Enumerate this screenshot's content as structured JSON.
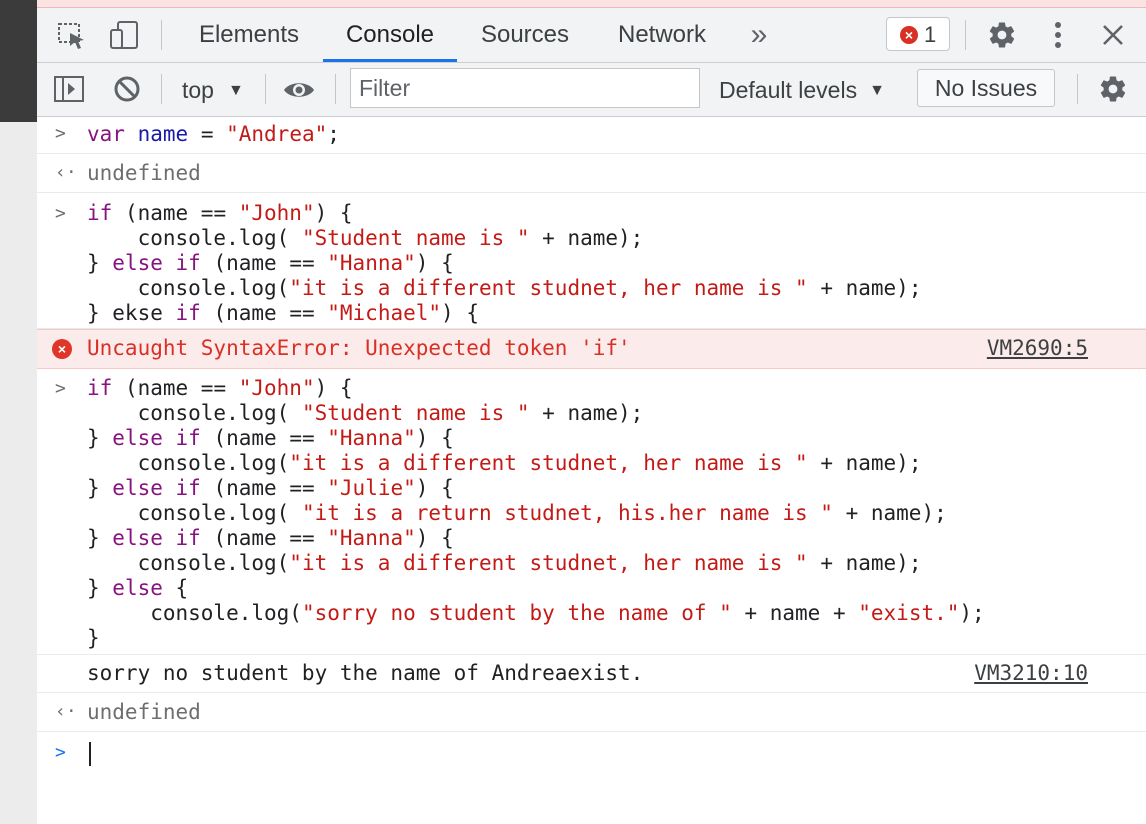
{
  "colors": {
    "accent": "#1a73e8",
    "error": "#d93025",
    "keyword": "#881280",
    "string": "#c41a16",
    "variable": "#1a1aa6"
  },
  "tabs": [
    {
      "label": "Elements"
    },
    {
      "label": "Console"
    },
    {
      "label": "Sources"
    },
    {
      "label": "Network"
    }
  ],
  "overflow_label": "»",
  "error_count": "1",
  "toolbar": {
    "context": "top",
    "filter_placeholder": "Filter",
    "levels": "Default levels",
    "issues": "No Issues"
  },
  "console": {
    "undefined_label": "undefined",
    "error_text": "Uncaught SyntaxError: Unexpected token 'if'",
    "error_link": "VM2690:5",
    "log_output": "sorry no student by the name of Andreaexist.",
    "log_link": "VM3210:10",
    "input1": {
      "kw": "var",
      "name": "name",
      "eq": " = ",
      "str": "\"Andrea\"",
      "end": ";"
    },
    "block1": [
      "if (name == \"John\") {",
      "    console.log( \"Student name is \" + name);",
      "} else if (name == \"Hanna\") {",
      "    console.log(\"it is a different studnet, her name is \" + name);",
      "} ekse if (name == \"Michael\") {"
    ],
    "block2": [
      "if (name == \"John\") {",
      "    console.log( \"Student name is \" + name);",
      "} else if (name == \"Hanna\") {",
      "    console.log(\"it is a different studnet, her name is \" + name);",
      "} else if (name == \"Julie\") {",
      "    console.log( \"it is a return studnet, his.her name is \" + name);",
      "} else if (name == \"Hanna\") {",
      "    console.log(\"it is a different studnet, her name is \" + name);",
      "} else {",
      "     console.log(\"sorry no student by the name of \" + name + \"exist.\");",
      "}"
    ]
  }
}
